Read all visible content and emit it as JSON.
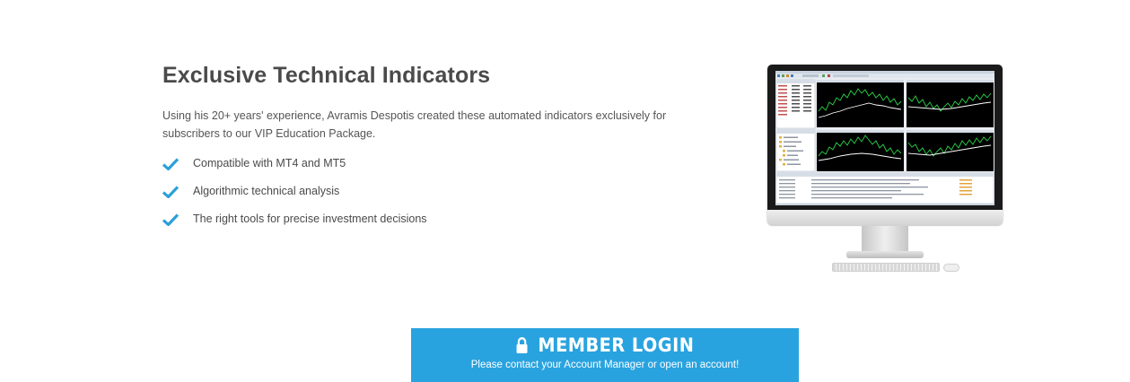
{
  "section": {
    "title": "Exclusive Technical Indicators",
    "description": "Using his 20+ years' experience, Avramis Despotis created these automated indicators exclusively for subscribers to our VIP Education Package.",
    "features": [
      "Compatible with MT4 and MT5",
      "Algorithmic technical analysis",
      "The right tools for precise investment decisions"
    ]
  },
  "member_login": {
    "title": "MEMBER LOGIN",
    "subtitle": "Please contact your Account Manager or open an account!"
  },
  "colors": {
    "accent": "#29a3df",
    "check": "#2b9fd9",
    "heading": "#4a4a4a",
    "text": "#555555"
  },
  "icons": {
    "feature_bullet": "checkmark-icon",
    "login": "lock-icon",
    "illustration": "desktop-monitor-trading-platform"
  }
}
